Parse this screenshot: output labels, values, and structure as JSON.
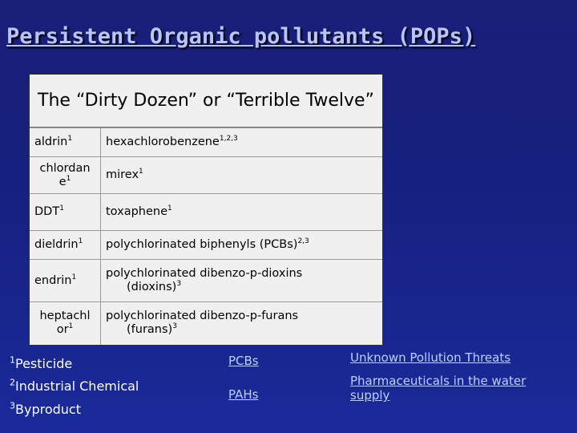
{
  "slide": {
    "title": "Persistent Organic pollutants (POPs)",
    "table_header": "The “Dirty Dozen” or “Terrible Twelve”",
    "rows": [
      {
        "left": "aldrin",
        "left_sup": "1",
        "right": "hexachlorobenzene",
        "right_sup": "1,2,3"
      },
      {
        "left_line1": "chlordan",
        "left_line2": "e",
        "left_sup": "1",
        "right": "mirex",
        "right_sup": "1"
      },
      {
        "left": "DDT",
        "left_sup": "1",
        "right": "toxaphene",
        "right_sup": "1"
      },
      {
        "left": "dieldrin",
        "left_sup": "1",
        "right": "polychlorinated biphenyls (PCBs)",
        "right_sup": "2,3"
      },
      {
        "left": "endrin",
        "left_sup": "1",
        "right_line1": "polychlorinated dibenzo-p-dioxins",
        "right_line2": "(dioxins)",
        "right_sup": "3"
      },
      {
        "left_line1": "heptachl",
        "left_line2": "or",
        "left_sup": "1",
        "right_line1": "polychlorinated dibenzo-p-furans",
        "right_line2": "(furans)",
        "right_sup": "3"
      }
    ],
    "legend": [
      {
        "sup": "1",
        "text": "Pesticide"
      },
      {
        "sup": "2",
        "text": "Industrial Chemical"
      },
      {
        "sup": "3",
        "text": "Byproduct"
      }
    ],
    "links": {
      "pcbs": "PCBs",
      "pahs": "PAHs",
      "unknown_threats": "Unknown Pollution Threats",
      "pharmaceuticals_line1": "Pharmaceuticals in the water",
      "pharmaceuticals_line2": "supply"
    }
  }
}
